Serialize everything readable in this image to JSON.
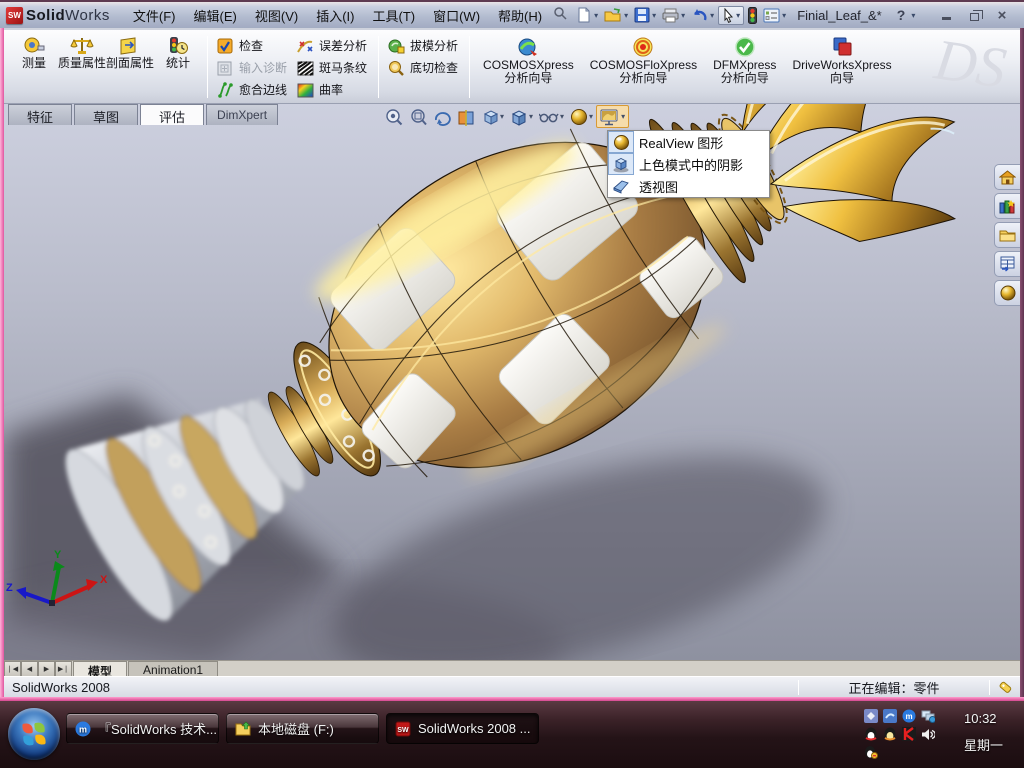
{
  "titlebar": {
    "logo_text": "SW",
    "brand_bold": "Solid",
    "brand_light": "Works",
    "menus": [
      "文件(F)",
      "编辑(E)",
      "视图(V)",
      "插入(I)",
      "工具(T)",
      "窗口(W)",
      "帮助(H)"
    ],
    "document_title": "Finial_Leaf_&*",
    "help_label": "?"
  },
  "toolbar": {
    "measure": "测量",
    "mass_properties": "质量属性",
    "section_properties": "剖面属性",
    "statistics": "统计",
    "check": "检查",
    "import_diagnostics": "输入诊断",
    "heal_edges": "愈合边线",
    "deviation_analysis": "误差分析",
    "zebra_stripes": "斑马条纹",
    "curvature": "曲率",
    "draft_analysis": "拔模分析",
    "undercut_check": "底切检查",
    "xpress": [
      {
        "name": "COSMOSXpress",
        "sub": "分析向导"
      },
      {
        "name": "COSMOSFloXpress",
        "sub": "分析向导"
      },
      {
        "name": "DFMXpress",
        "sub": "分析向导"
      },
      {
        "name": "DriveWorksXpress",
        "sub": "向导"
      }
    ],
    "watermark": "DS"
  },
  "command_tabs": [
    "特征",
    "草图",
    "评估",
    "DimXpert"
  ],
  "realview_menu": [
    "RealView 图形",
    "上色模式中的阴影",
    "透视图"
  ],
  "bottom_tabs": [
    "模型",
    "Animation1"
  ],
  "statusbar": {
    "app_version": "SolidWorks 2008",
    "editing_status": "正在编辑：零件"
  },
  "taskbar": {
    "buttons": [
      "『SolidWorks 技术...",
      "本地磁盘 (F:)",
      "SolidWorks 2008 ..."
    ],
    "time": "10:32",
    "day": "星期一"
  },
  "triad": {
    "x": "X",
    "y": "Y",
    "z": "Z"
  },
  "colors": {
    "accent_gold": "#d4a017",
    "viewport_top": "#cdd0df",
    "viewport_bottom": "#8e91a0",
    "taskbar_dark": "#241317",
    "window_border_pink": "#e0559e"
  }
}
